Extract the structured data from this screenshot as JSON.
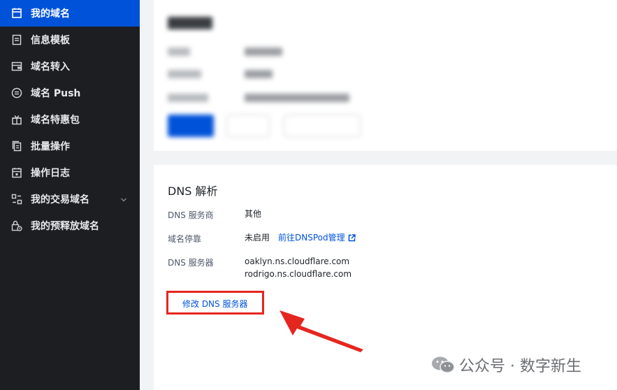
{
  "sidebar": {
    "items": [
      {
        "label": "我的域名",
        "icon": "calendar-icon",
        "active": true
      },
      {
        "label": "信息模板",
        "icon": "document-icon"
      },
      {
        "label": "域名转入",
        "icon": "wallet-icon"
      },
      {
        "label": "域名 Push",
        "icon": "transfer-circle-icon"
      },
      {
        "label": "域名特惠包",
        "icon": "gift-icon"
      },
      {
        "label": "批量操作",
        "icon": "copy-icon"
      },
      {
        "label": "操作日志",
        "icon": "log-icon"
      },
      {
        "label": "我的交易域名",
        "icon": "trade-icon",
        "has_submenu": true
      },
      {
        "label": "我的预释放域名",
        "icon": "lock-clock-icon"
      }
    ]
  },
  "dns_card": {
    "title": "DNS 解析",
    "provider_label": "DNS 服务商",
    "provider_value": "其他",
    "parking_label": "域名停靠",
    "parking_value": "未启用",
    "parking_link": "前往DNSPod管理",
    "servers_label": "DNS 服务器",
    "servers": [
      "oaklyn.ns.cloudflare.com",
      "rodrigo.ns.cloudflare.com"
    ],
    "edit_link": "修改 DNS 服务器"
  },
  "watermark": {
    "text": "公众号 · 数字新生"
  },
  "colors": {
    "sidebar_bg": "#1c1e22",
    "active_bg": "#0052d9",
    "link": "#0052d9",
    "highlight_red": "#e5261f"
  }
}
